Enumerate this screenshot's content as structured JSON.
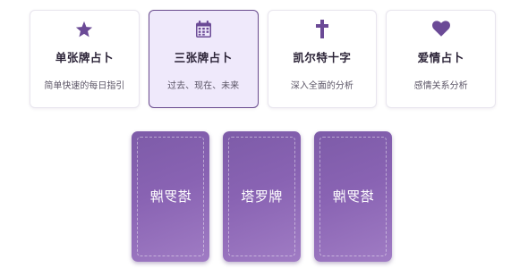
{
  "spreads": [
    {
      "icon": "star-icon",
      "title": "单张牌占卜",
      "description": "简单快速的每日指引",
      "selected": false
    },
    {
      "icon": "calendar-icon",
      "title": "三张牌占卜",
      "description": "过去、现在、未来",
      "selected": true
    },
    {
      "icon": "cross-icon",
      "title": "凯尔特十字",
      "description": "深入全面的分析",
      "selected": false
    },
    {
      "icon": "heart-icon",
      "title": "爱情占卜",
      "description": "感情关系分析",
      "selected": false
    }
  ],
  "cards": [
    {
      "label": "塔罗牌",
      "orientation": "mirrored"
    },
    {
      "label": "塔罗牌",
      "orientation": "upright"
    },
    {
      "label": "塔罗牌",
      "orientation": "mirrored"
    }
  ],
  "colors": {
    "accent": "#6a4c8f",
    "icon": "#6b4a96",
    "selected_bg": "#efe9fb",
    "card_gradient_start": "#7d5ba8",
    "card_gradient_end": "#a07cc4"
  }
}
